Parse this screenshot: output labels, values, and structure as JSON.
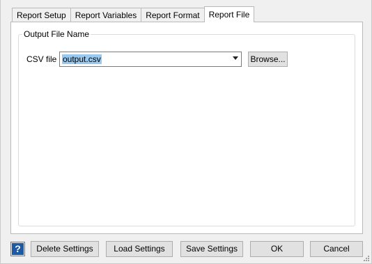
{
  "tabs": [
    {
      "label": "Report Setup",
      "active": false
    },
    {
      "label": "Report Variables",
      "active": false
    },
    {
      "label": "Report Format",
      "active": false
    },
    {
      "label": "Report File",
      "active": true
    }
  ],
  "output_group": {
    "title": "Output File Name",
    "csv_label": "CSV file",
    "csv_value": "output.csv",
    "browse_label": "Browse..."
  },
  "footer": {
    "help_icon": "help-question-icon",
    "help_glyph": "?",
    "delete_label": "Delete Settings",
    "load_label": "Load Settings",
    "save_label": "Save Settings",
    "ok_label": "OK",
    "cancel_label": "Cancel"
  },
  "colors": {
    "selection": "#99c9ef",
    "help_blue": "#1c5aa6"
  }
}
